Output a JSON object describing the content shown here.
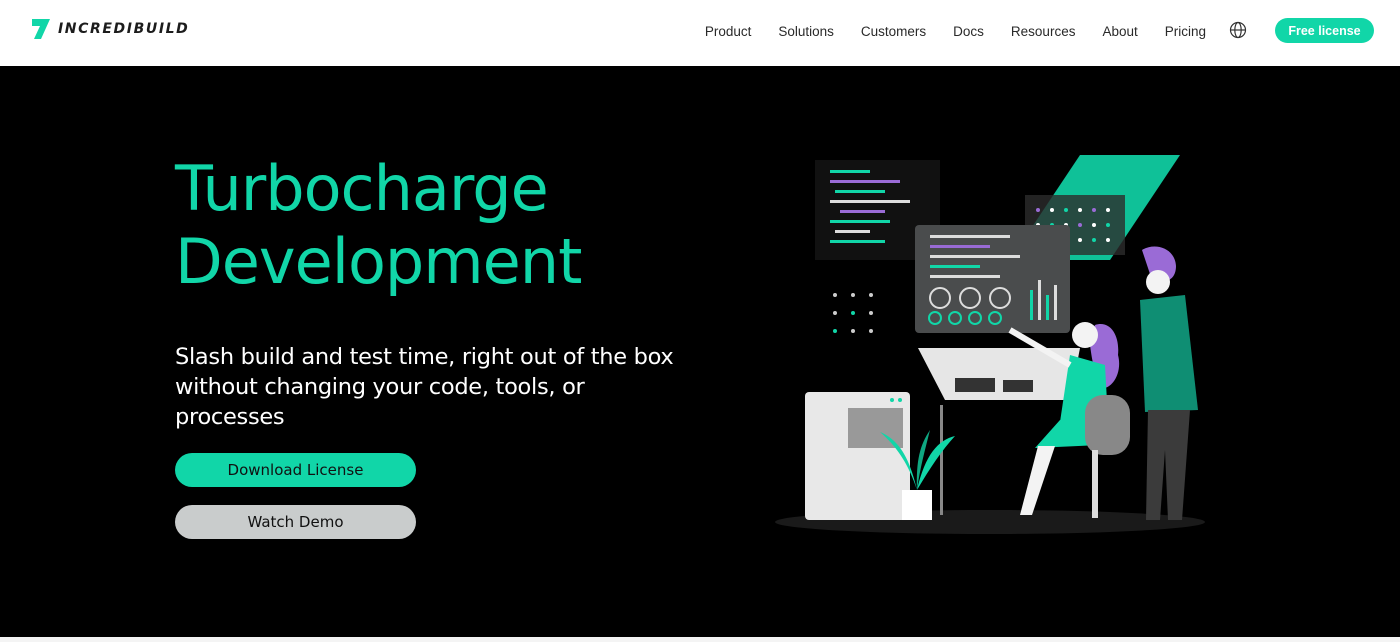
{
  "brand": {
    "name": "INCREDIBUILD",
    "accent": "#11d6a8"
  },
  "nav": {
    "items": [
      "Product",
      "Solutions",
      "Customers",
      "Docs",
      "Resources",
      "About",
      "Pricing"
    ],
    "globe_icon": "globe-icon",
    "cta": "Free license"
  },
  "hero": {
    "title_line1": "Turbocharge",
    "title_line2": "Development",
    "subtitle": "Slash build and test time, right out of the box without changing your code, tools, or processes",
    "primary_button": "Download License",
    "secondary_button": "Watch Demo"
  }
}
